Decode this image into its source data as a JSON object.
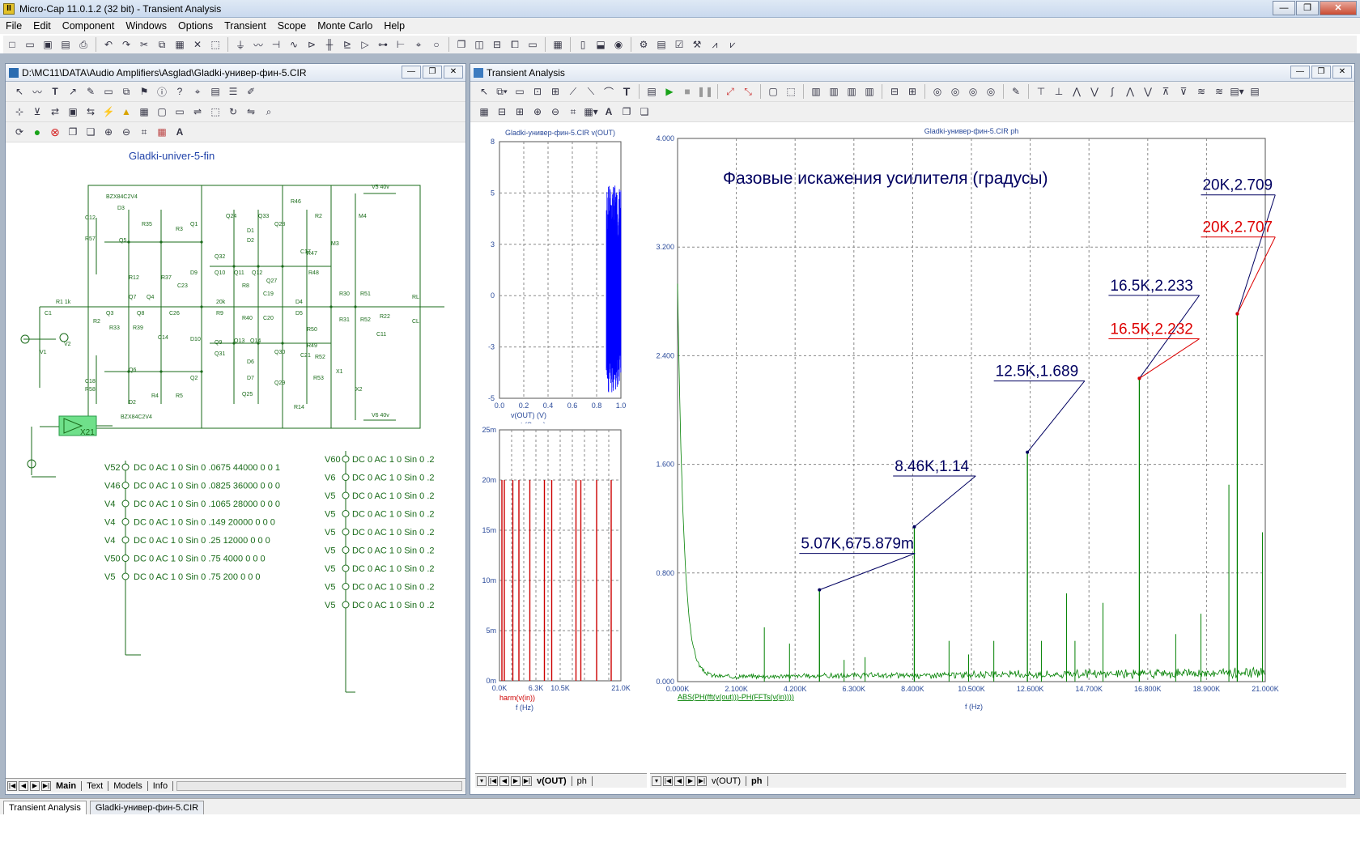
{
  "window": {
    "title": "Micro-Cap 11.0.1.2 (32 bit) - Transient Analysis",
    "app_icon": "II",
    "min": "—",
    "max": "❐",
    "close": "✕"
  },
  "menu": [
    "File",
    "Edit",
    "Component",
    "Windows",
    "Options",
    "Transient",
    "Scope",
    "Monte Carlo",
    "Help"
  ],
  "schematic": {
    "path": "D:\\MC11\\DATA\\Audio Amplifiers\\Asglad\\Gladki-универ-фин-5.CIR",
    "title": "Gladki-univer-5-fin",
    "block_label": "X21",
    "sources_left": [
      {
        "ref": "V52",
        "text": "DC 0 AC 1 0 Sin 0 .0675 44000 0 0 1"
      },
      {
        "ref": "V46",
        "text": "DC 0 AC 1 0 Sin 0 .0825 36000 0 0 0"
      },
      {
        "ref": "V4",
        "text": "DC 0 AC 1 0 Sin 0 .1065 28000 0 0 0"
      },
      {
        "ref": "V4",
        "text": "DC 0 AC 1 0 Sin 0 .149 20000 0 0 0"
      },
      {
        "ref": "V4",
        "text": "DC 0 AC 1 0 Sin 0 .25 12000 0 0 0"
      },
      {
        "ref": "V50",
        "text": "DC 0 AC 1 0 Sin 0 .75 4000 0 0 0"
      },
      {
        "ref": "V5",
        "text": "DC 0 AC 1 0 Sin 0 .75 200 0 0 0"
      }
    ],
    "sources_right": [
      {
        "ref": "V60",
        "text": "DC 0 AC 1 0 Sin 0 .2"
      },
      {
        "ref": "V6",
        "text": "DC 0 AC 1 0 Sin 0 .2"
      },
      {
        "ref": "V5",
        "text": "DC 0 AC 1 0 Sin 0 .2"
      },
      {
        "ref": "V5",
        "text": "DC 0 AC 1 0 Sin 0 .2"
      },
      {
        "ref": "V5",
        "text": "DC 0 AC 1 0 Sin 0 .2"
      },
      {
        "ref": "V5",
        "text": "DC 0 AC 1 0 Sin 0 .2"
      },
      {
        "ref": "V5",
        "text": "DC 0 AC 1 0 Sin 0 .2"
      },
      {
        "ref": "V5",
        "text": "DC 0 AC 1 0 Sin 0 .2"
      },
      {
        "ref": "V5",
        "text": "DC 0 AC 1 0 Sin 0 .2"
      }
    ],
    "tabs": [
      "Main",
      "Text",
      "Models",
      "Info"
    ],
    "active_tab": "Main"
  },
  "analysis": {
    "title": "Transient Analysis",
    "tabs": [
      "v(OUT)",
      "ph"
    ],
    "active_tab": "ph",
    "tabs_mid": [
      "v(OUT)",
      "ph"
    ],
    "active_tab_mid": "v(OUT)"
  },
  "chart_data": [
    {
      "type": "line",
      "title": "Gladki-универ-фин-5.CIR v(OUT)",
      "xlabel": "t (Secs)",
      "ylabel": "v(OUT) (V)",
      "xlim": [
        0,
        1.0
      ],
      "ylim": [
        -5,
        8
      ],
      "x_ticks": [
        "0.0",
        "0.2",
        "0.4",
        "0.6",
        "0.8",
        "1.0"
      ],
      "y_ticks": [
        "8",
        "5",
        "3",
        "0",
        "-3",
        "-5"
      ],
      "color": "#0000ff",
      "burst_x": [
        0.88,
        1.0
      ],
      "burst_amplitude": [
        -4.8,
        5.8
      ],
      "grid": true
    },
    {
      "type": "bar",
      "title": "",
      "xlabel": "f (Hz)",
      "ylabel": "harm(v(in))",
      "xlim": [
        0,
        21000
      ],
      "ylim": [
        0,
        0.025
      ],
      "x_ticks": [
        "0.0K",
        "6.3K",
        "10.5K",
        "21.0K"
      ],
      "y_ticks": [
        "25m",
        "20m",
        "15m",
        "10m",
        "5m",
        "0m"
      ],
      "color": "#cc0000",
      "x": [
        200,
        4000,
        12000,
        20000,
        28000,
        36000,
        44000
      ],
      "values": [
        0.02,
        0.02,
        0.02,
        0.02,
        0.02,
        0.02,
        0.02
      ],
      "grid": true
    },
    {
      "type": "line",
      "title": "Gladki-универ-фин-5.CIR ph",
      "xlabel": "f (Hz)",
      "ylabel": "ABS(PH(fft(v(out)))-PH(FFTs(v(in))))",
      "annotation_title": "Фазовые искажения усилителя (градусы)",
      "xlim": [
        0,
        21000
      ],
      "ylim": [
        0,
        4
      ],
      "x_ticks": [
        "0.000K",
        "2.100K",
        "4.200K",
        "6.300K",
        "8.400K",
        "10.500K",
        "12.600K",
        "14.700K",
        "16.800K",
        "18.900K",
        "21.000K"
      ],
      "y_ticks": [
        "4.000",
        "3.200",
        "2.400",
        "1.600",
        "0.800",
        "0.000"
      ],
      "color": "#008000",
      "grid": true,
      "peaks": [
        {
          "x": 5070,
          "y": 0.676
        },
        {
          "x": 8460,
          "y": 1.14
        },
        {
          "x": 12500,
          "y": 1.689
        },
        {
          "x": 16500,
          "y": 2.233
        },
        {
          "x": 20000,
          "y": 2.709
        }
      ],
      "labels": [
        {
          "text": "5.07K,675.879m",
          "color": "#000060"
        },
        {
          "text": "8.46K,1.14",
          "color": "#000060"
        },
        {
          "text": "12.5K,1.689",
          "color": "#000060"
        },
        {
          "text": "16.5K,2.233",
          "color": "#000060"
        },
        {
          "text": "16.5K,2.232",
          "color": "#dd0000"
        },
        {
          "text": "20K,2.709",
          "color": "#000060"
        },
        {
          "text": "20K,2.707",
          "color": "#dd0000"
        }
      ]
    }
  ],
  "taskbar": [
    "Transient Analysis",
    "Gladki-универ-фин-5.CIR"
  ]
}
